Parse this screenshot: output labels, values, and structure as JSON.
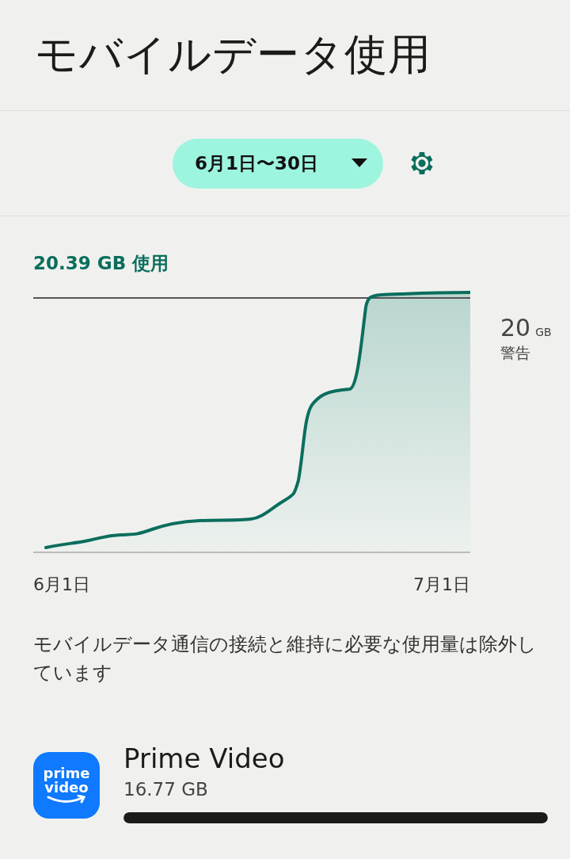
{
  "title": "モバイルデータ使用",
  "period": {
    "label": "6月1日〜30日"
  },
  "usage": {
    "total": "20.39 GB 使用",
    "warning": {
      "value": "20",
      "unit": "GB",
      "label": "警告"
    },
    "x_start": "6月1日",
    "x_end": "7月1日"
  },
  "note": "モバイルデータ通信の接続と維持に必要な使用量は除外しています",
  "apps": [
    {
      "name": "Prime Video",
      "amount": "16.77 GB",
      "level": 1,
      "icon_text": [
        "prime",
        "video"
      ]
    }
  ]
}
